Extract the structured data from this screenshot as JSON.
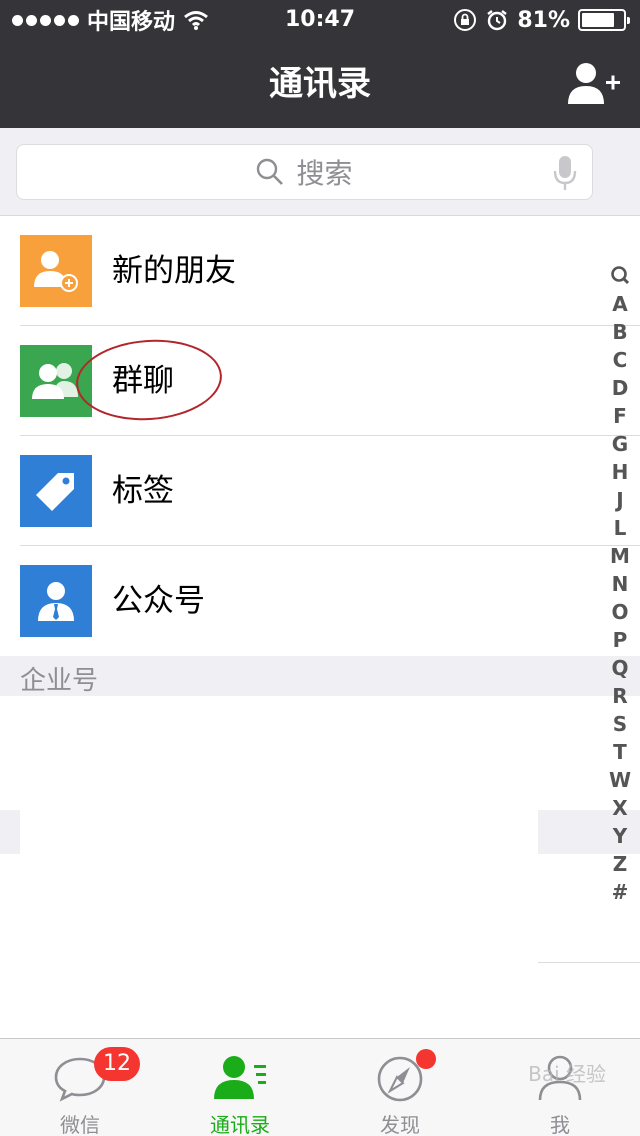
{
  "status_bar": {
    "carrier": "中国移动",
    "time": "10:47",
    "battery": "81%",
    "battery_level": 0.81
  },
  "nav": {
    "title": "通讯录",
    "add_icon": "add-contact-icon"
  },
  "search": {
    "placeholder": "搜索",
    "icon": "search-icon",
    "mic_icon": "microphone-icon"
  },
  "contacts_menu": [
    {
      "label": "新的朋友",
      "icon": "new-friend-icon",
      "color": "#f8a13c"
    },
    {
      "label": "群聊",
      "icon": "group-chat-icon",
      "color": "#3aa650"
    },
    {
      "label": "标签",
      "icon": "tag-icon",
      "color": "#2f7fd6"
    },
    {
      "label": "公众号",
      "icon": "official-account-icon",
      "color": "#2f7fd6"
    }
  ],
  "section": {
    "enterprise": "企业号"
  },
  "index_bar": [
    "A",
    "B",
    "C",
    "D",
    "F",
    "G",
    "H",
    "J",
    "L",
    "M",
    "N",
    "O",
    "P",
    "Q",
    "R",
    "S",
    "T",
    "W",
    "X",
    "Y",
    "Z",
    "#"
  ],
  "tabbar": {
    "tabs": [
      {
        "label": "微信",
        "icon": "chat-bubble-icon",
        "badge": "12"
      },
      {
        "label": "通讯录",
        "icon": "contacts-icon",
        "active": true
      },
      {
        "label": "发现",
        "icon": "compass-icon",
        "dot": true
      },
      {
        "label": "我",
        "icon": "person-icon"
      }
    ]
  },
  "watermark": "Bai 经验",
  "colors": {
    "accent_green": "#1aad19",
    "nav_bg": "#353539",
    "badge_red": "#f43530"
  }
}
